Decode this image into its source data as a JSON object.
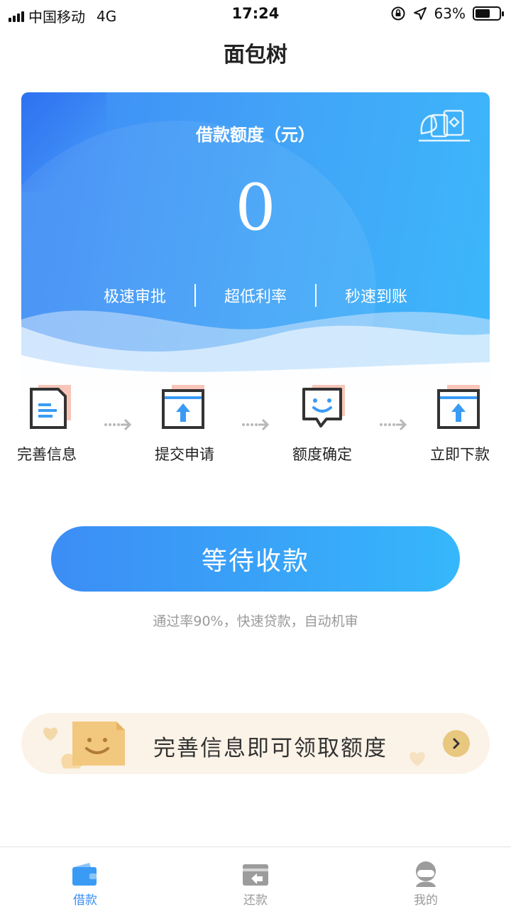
{
  "status_bar": {
    "carrier": "中国移动",
    "network": "4G",
    "time": "17:24",
    "battery_percent": "63%",
    "battery_level": 0.63
  },
  "header": {
    "title": "面包树"
  },
  "card": {
    "label": "借款额度（元）",
    "amount": "0",
    "features": [
      "极速审批",
      "超低利率",
      "秒速到账"
    ]
  },
  "steps": [
    {
      "label": "完善信息",
      "icon": "document-icon"
    },
    {
      "label": "提交申请",
      "icon": "upload-window-icon"
    },
    {
      "label": "额度确定",
      "icon": "smile-bubble-icon"
    },
    {
      "label": "立即下款",
      "icon": "upload-window-icon"
    }
  ],
  "main_button": {
    "label": "等待收款"
  },
  "note": "通过率90%，快速贷款，自动机审",
  "banner": {
    "text": "完善信息即可领取额度",
    "icon": "chevron-right-icon"
  },
  "tabbar": [
    {
      "label": "借款",
      "icon": "wallet-icon",
      "active": true
    },
    {
      "label": "还款",
      "icon": "return-card-icon",
      "active": false
    },
    {
      "label": "我的",
      "icon": "user-icon",
      "active": false
    }
  ],
  "colors": {
    "primary": "#3c8df5",
    "accent": "#36b7fb",
    "inactive": "#9a9a9a",
    "banner_bg": "#fbf3e7"
  }
}
